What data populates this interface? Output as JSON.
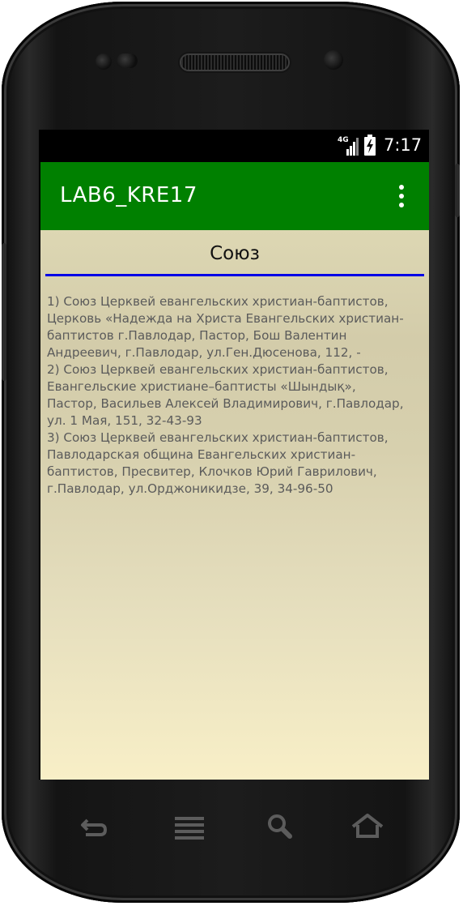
{
  "status_bar": {
    "network": "4G",
    "time": "7:17"
  },
  "app_bar": {
    "title": "LAB6_KRE17",
    "menu_icon": "more-vert-icon"
  },
  "content": {
    "heading": "Союз",
    "lines": [
      "1) Союз Церквей евангельских христиан-баптистов,",
      "Церковь «Надежда на Христа Евангельских христиан-",
      "баптистов г.Павлодар, Пастор, Бош Валентин",
      "Андреевич, г.Павлодар, ул.Ген.Дюсенова, 112, -",
      "2) Союз Церквей евангельских христиан-баптистов,",
      "Евангельские христиане–баптисты «Шындық»,",
      "Пастор, Васильев Алексей Владимирович, г.Павлодар,",
      "ул. 1 Мая, 151, 32-43-93",
      "3) Союз Церквей евангельских христиан-баптистов,",
      "Павлодарская община Евангельских христиан-",
      "баптистов, Пресвитер, Клочков Юрий Гаврилович,",
      "г.Павлодар, ул.Орджоникидзе, 39, 34-96-50"
    ]
  },
  "nav_bar": {
    "buttons": [
      "back-icon",
      "menu-icon",
      "search-icon",
      "home-icon"
    ]
  },
  "colors": {
    "app_bar": "#008000",
    "divider": "#0000e6",
    "body_text": "#5b5b5b"
  }
}
